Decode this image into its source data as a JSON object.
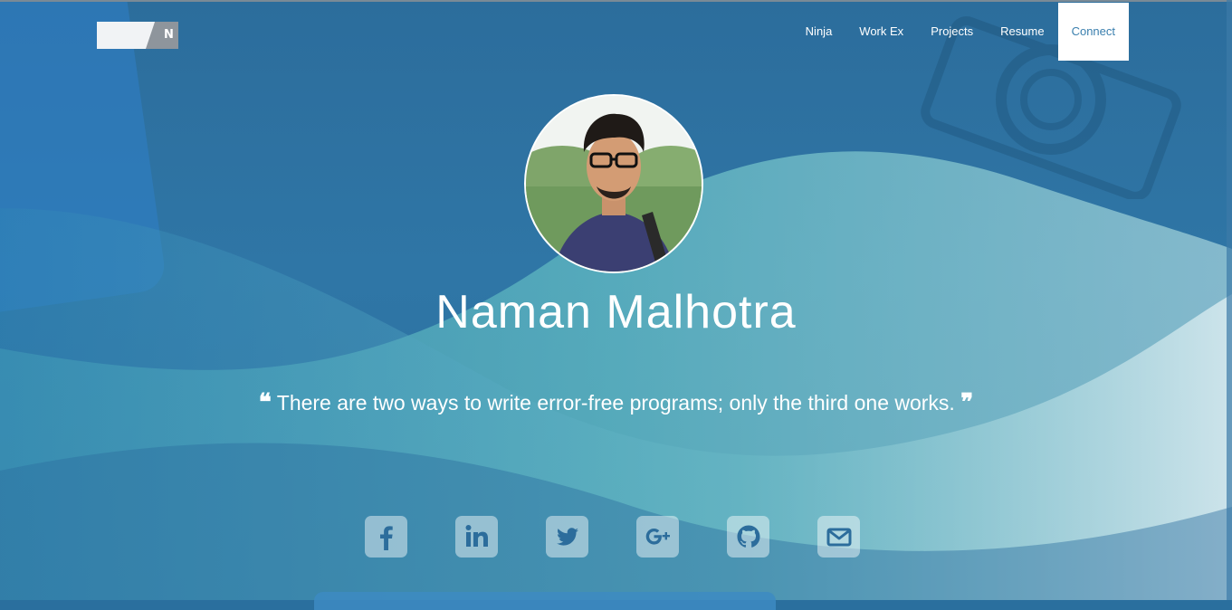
{
  "header": {
    "logo_letter": "N",
    "nav": [
      {
        "label": "Ninja"
      },
      {
        "label": "Work Ex"
      },
      {
        "label": "Projects"
      },
      {
        "label": "Resume"
      },
      {
        "label": "Connect",
        "active": true
      }
    ]
  },
  "profile": {
    "name": "Naman Malhotra",
    "quote_open": "❝",
    "quote": "There are two ways to write error-free programs; only the third one works.",
    "quote_close": "❞"
  },
  "socials": [
    {
      "icon": "facebook-icon"
    },
    {
      "icon": "linkedin-icon"
    },
    {
      "icon": "twitter-icon"
    },
    {
      "icon": "google-plus-icon"
    },
    {
      "icon": "github-icon"
    },
    {
      "icon": "email-icon"
    }
  ],
  "colors": {
    "background": "#2c6d9c",
    "wave_light": "#5fb3be",
    "nav_active_bg": "#ffffff",
    "nav_active_text": "#3a7fae"
  }
}
